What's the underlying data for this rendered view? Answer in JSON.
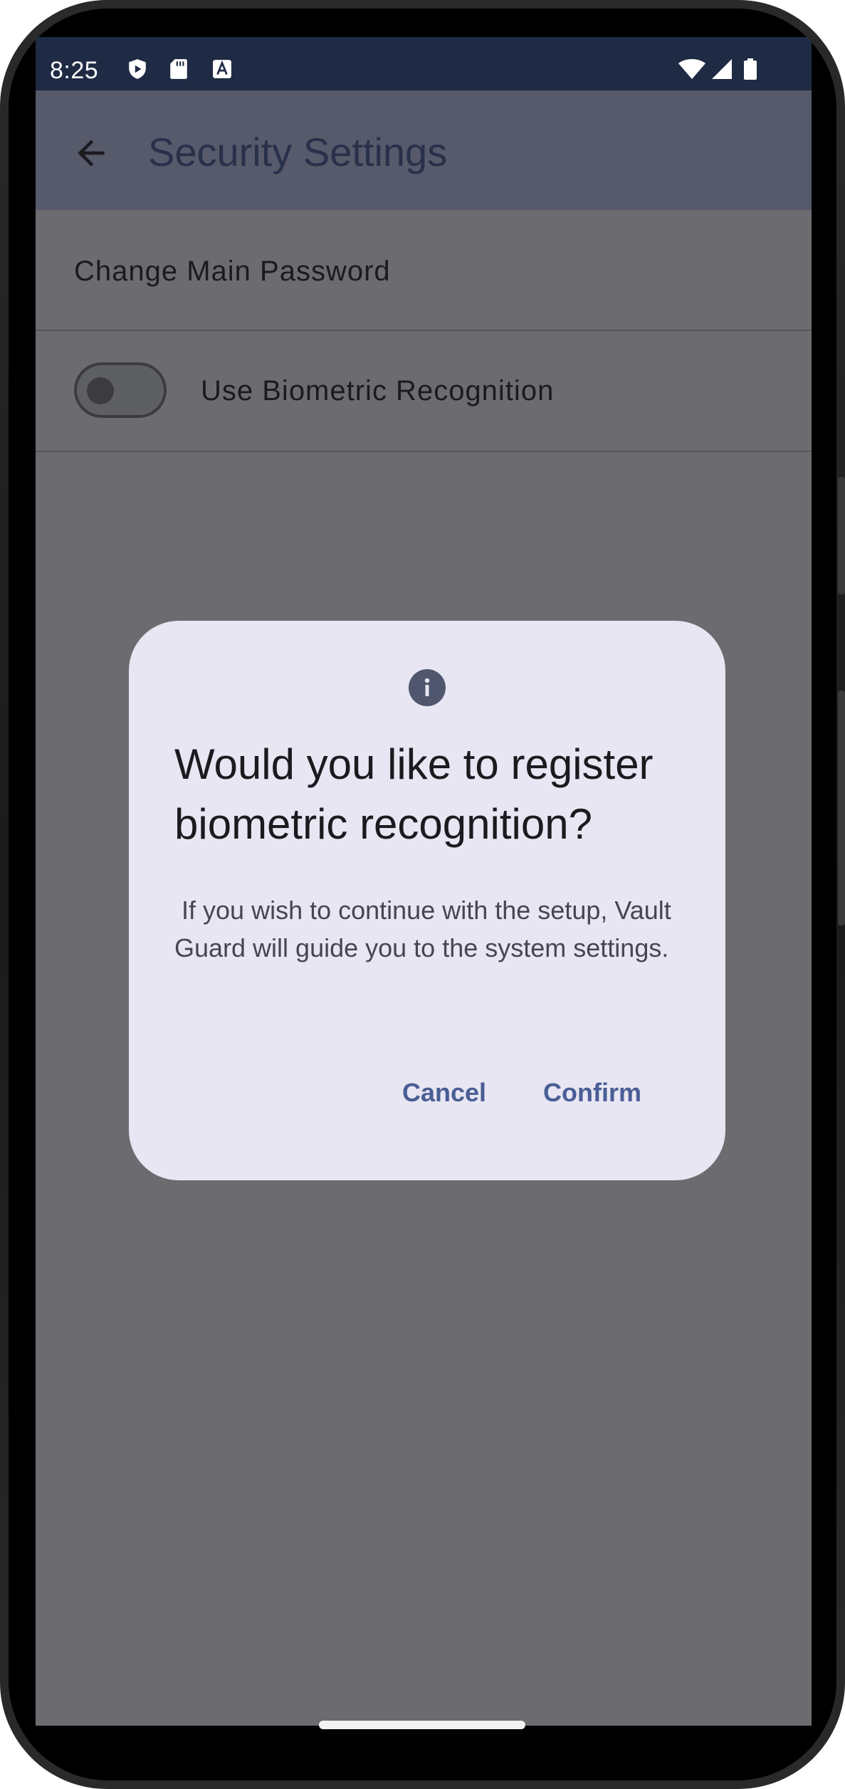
{
  "status_bar": {
    "time": "8:25",
    "icons": [
      "shield-icon",
      "sd-card-icon",
      "font-icon",
      "wifi-icon",
      "signal-icon",
      "battery-icon"
    ]
  },
  "app_bar": {
    "back_icon": "arrow-left-icon",
    "title": "Security Settings"
  },
  "settings": {
    "change_password_label": "Change Main Password",
    "biometric_label": "Use Biometric Recognition",
    "biometric_enabled": false
  },
  "dialog": {
    "icon": "info-icon",
    "title": "Would you like to register biometric recognition?",
    "body": " If you wish to continue with the setup, Vault Guard will guide you to the system settings.",
    "cancel_label": "Cancel",
    "confirm_label": "Confirm"
  },
  "colors": {
    "accent": "#4a5e95",
    "dialog_bg": "#e7e6f2",
    "scrim": "#6c6c70",
    "app_bar": "#565a6b"
  }
}
